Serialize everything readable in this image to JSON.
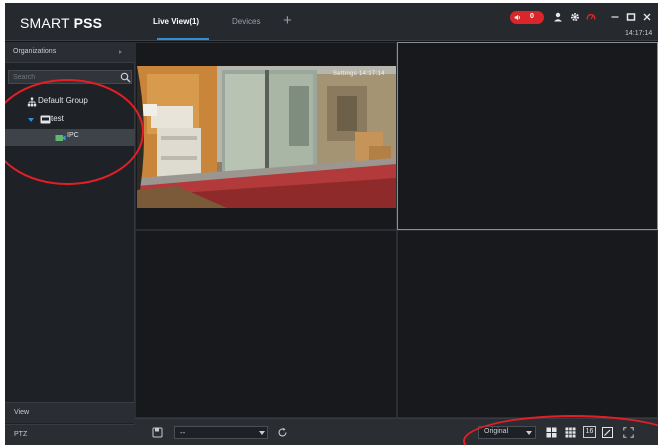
{
  "app": {
    "brand_light": "SMART ",
    "brand_bold": "PSS"
  },
  "tabs": [
    {
      "label": "Live View(1)",
      "active": true
    },
    {
      "label": "Devices",
      "active": false
    }
  ],
  "titlebar": {
    "alarm_count": "0",
    "clock": "14:17:14"
  },
  "sidebar": {
    "organizations_label": "Organizations",
    "search_placeholder": "Search",
    "tree": {
      "group_label": "Default Group",
      "device_label": "test",
      "channel_label": "IPC"
    },
    "view_label": "View",
    "ptz_label": "PTZ"
  },
  "video": {
    "camera_timestamp": "Settings 14:17:14"
  },
  "bottombar": {
    "layout_value": "--",
    "ratio_value": "Original",
    "split_16_label": "16"
  },
  "colors": {
    "accent": "#2d8fd8",
    "alarm": "#d8262a",
    "annotation": "#e21f26",
    "window_bg": "#111318"
  }
}
